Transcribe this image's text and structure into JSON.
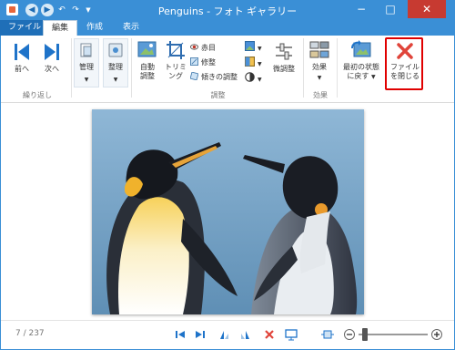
{
  "window": {
    "title": "Penguins - フォト ギャラリー"
  },
  "tabs": {
    "file": "ファイル",
    "edit": "編集",
    "create": "作成",
    "view": "表示"
  },
  "ribbon": {
    "prev": "前へ",
    "next": "次へ",
    "repeat_group": "繰り返し",
    "manage": "管理",
    "organize": "整理",
    "auto_adjust": "自動\n調整",
    "trim": "トリミ\nング",
    "red_eye": "赤目",
    "retouch": "修整",
    "straighten": "傾きの調整",
    "adjust_group": "調整",
    "fine_tune": "微調整",
    "effects": "効果",
    "effects_group": "効果",
    "revert": "最初の状態\nに戻す",
    "close_file": "ファイル\nを閉じる"
  },
  "status": {
    "counter": "7 / 237"
  },
  "colors": {
    "accent": "#3a8fd6",
    "highlight": "#e00000"
  }
}
